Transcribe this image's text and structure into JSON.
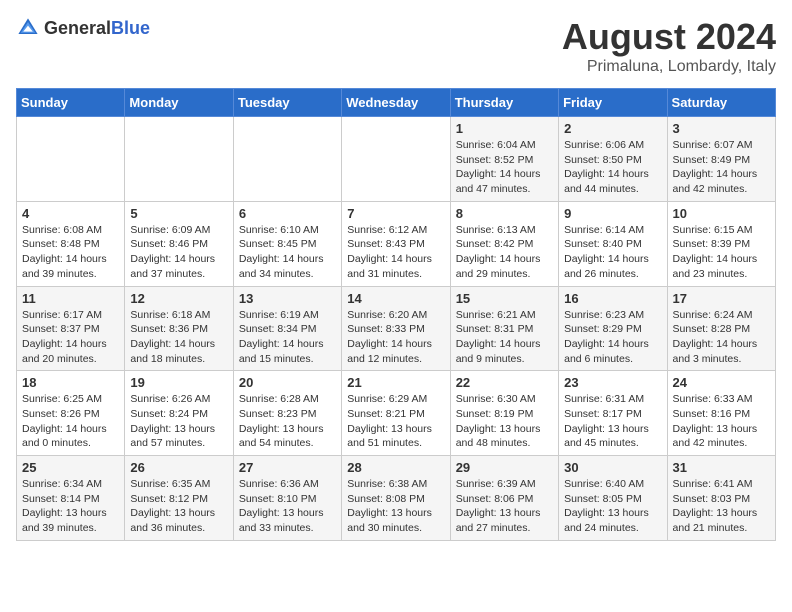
{
  "header": {
    "logo_general": "General",
    "logo_blue": "Blue",
    "title": "August 2024",
    "subtitle": "Primaluna, Lombardy, Italy"
  },
  "days_of_week": [
    "Sunday",
    "Monday",
    "Tuesday",
    "Wednesday",
    "Thursday",
    "Friday",
    "Saturday"
  ],
  "weeks": [
    [
      {
        "day": "",
        "info": ""
      },
      {
        "day": "",
        "info": ""
      },
      {
        "day": "",
        "info": ""
      },
      {
        "day": "",
        "info": ""
      },
      {
        "day": "1",
        "info": "Sunrise: 6:04 AM\nSunset: 8:52 PM\nDaylight: 14 hours and 47 minutes."
      },
      {
        "day": "2",
        "info": "Sunrise: 6:06 AM\nSunset: 8:50 PM\nDaylight: 14 hours and 44 minutes."
      },
      {
        "day": "3",
        "info": "Sunrise: 6:07 AM\nSunset: 8:49 PM\nDaylight: 14 hours and 42 minutes."
      }
    ],
    [
      {
        "day": "4",
        "info": "Sunrise: 6:08 AM\nSunset: 8:48 PM\nDaylight: 14 hours and 39 minutes."
      },
      {
        "day": "5",
        "info": "Sunrise: 6:09 AM\nSunset: 8:46 PM\nDaylight: 14 hours and 37 minutes."
      },
      {
        "day": "6",
        "info": "Sunrise: 6:10 AM\nSunset: 8:45 PM\nDaylight: 14 hours and 34 minutes."
      },
      {
        "day": "7",
        "info": "Sunrise: 6:12 AM\nSunset: 8:43 PM\nDaylight: 14 hours and 31 minutes."
      },
      {
        "day": "8",
        "info": "Sunrise: 6:13 AM\nSunset: 8:42 PM\nDaylight: 14 hours and 29 minutes."
      },
      {
        "day": "9",
        "info": "Sunrise: 6:14 AM\nSunset: 8:40 PM\nDaylight: 14 hours and 26 minutes."
      },
      {
        "day": "10",
        "info": "Sunrise: 6:15 AM\nSunset: 8:39 PM\nDaylight: 14 hours and 23 minutes."
      }
    ],
    [
      {
        "day": "11",
        "info": "Sunrise: 6:17 AM\nSunset: 8:37 PM\nDaylight: 14 hours and 20 minutes."
      },
      {
        "day": "12",
        "info": "Sunrise: 6:18 AM\nSunset: 8:36 PM\nDaylight: 14 hours and 18 minutes."
      },
      {
        "day": "13",
        "info": "Sunrise: 6:19 AM\nSunset: 8:34 PM\nDaylight: 14 hours and 15 minutes."
      },
      {
        "day": "14",
        "info": "Sunrise: 6:20 AM\nSunset: 8:33 PM\nDaylight: 14 hours and 12 minutes."
      },
      {
        "day": "15",
        "info": "Sunrise: 6:21 AM\nSunset: 8:31 PM\nDaylight: 14 hours and 9 minutes."
      },
      {
        "day": "16",
        "info": "Sunrise: 6:23 AM\nSunset: 8:29 PM\nDaylight: 14 hours and 6 minutes."
      },
      {
        "day": "17",
        "info": "Sunrise: 6:24 AM\nSunset: 8:28 PM\nDaylight: 14 hours and 3 minutes."
      }
    ],
    [
      {
        "day": "18",
        "info": "Sunrise: 6:25 AM\nSunset: 8:26 PM\nDaylight: 14 hours and 0 minutes."
      },
      {
        "day": "19",
        "info": "Sunrise: 6:26 AM\nSunset: 8:24 PM\nDaylight: 13 hours and 57 minutes."
      },
      {
        "day": "20",
        "info": "Sunrise: 6:28 AM\nSunset: 8:23 PM\nDaylight: 13 hours and 54 minutes."
      },
      {
        "day": "21",
        "info": "Sunrise: 6:29 AM\nSunset: 8:21 PM\nDaylight: 13 hours and 51 minutes."
      },
      {
        "day": "22",
        "info": "Sunrise: 6:30 AM\nSunset: 8:19 PM\nDaylight: 13 hours and 48 minutes."
      },
      {
        "day": "23",
        "info": "Sunrise: 6:31 AM\nSunset: 8:17 PM\nDaylight: 13 hours and 45 minutes."
      },
      {
        "day": "24",
        "info": "Sunrise: 6:33 AM\nSunset: 8:16 PM\nDaylight: 13 hours and 42 minutes."
      }
    ],
    [
      {
        "day": "25",
        "info": "Sunrise: 6:34 AM\nSunset: 8:14 PM\nDaylight: 13 hours and 39 minutes."
      },
      {
        "day": "26",
        "info": "Sunrise: 6:35 AM\nSunset: 8:12 PM\nDaylight: 13 hours and 36 minutes."
      },
      {
        "day": "27",
        "info": "Sunrise: 6:36 AM\nSunset: 8:10 PM\nDaylight: 13 hours and 33 minutes."
      },
      {
        "day": "28",
        "info": "Sunrise: 6:38 AM\nSunset: 8:08 PM\nDaylight: 13 hours and 30 minutes."
      },
      {
        "day": "29",
        "info": "Sunrise: 6:39 AM\nSunset: 8:06 PM\nDaylight: 13 hours and 27 minutes."
      },
      {
        "day": "30",
        "info": "Sunrise: 6:40 AM\nSunset: 8:05 PM\nDaylight: 13 hours and 24 minutes."
      },
      {
        "day": "31",
        "info": "Sunrise: 6:41 AM\nSunset: 8:03 PM\nDaylight: 13 hours and 21 minutes."
      }
    ]
  ]
}
